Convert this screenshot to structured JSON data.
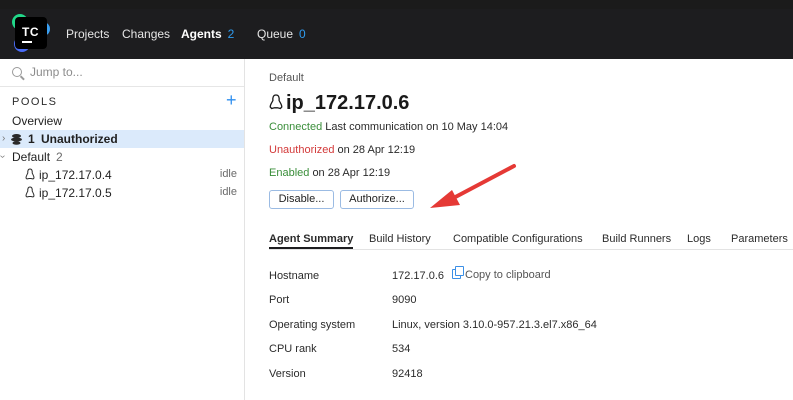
{
  "nav": {
    "logo_text": "TC",
    "projects": "Projects",
    "changes": "Changes",
    "agents": "Agents",
    "agents_count": "2",
    "queue": "Queue",
    "queue_count": "0"
  },
  "sidebar": {
    "search_placeholder": "Jump to...",
    "pools_label": "POOLS",
    "add_label": "+",
    "overview": "Overview",
    "unauthorized_count": "1",
    "unauthorized_label": "Unauthorized",
    "default_pool": "Default",
    "default_pool_count": "2",
    "agents": [
      {
        "name": "ip_172.17.0.4",
        "state": "idle"
      },
      {
        "name": "ip_172.17.0.5",
        "state": "idle"
      }
    ]
  },
  "main": {
    "breadcrumb": "Default",
    "agent_name": "ip_172.17.0.6",
    "connected_label": "Connected",
    "connected_text": "Last communication on 10 May 14:04",
    "unauthorized_label": "Unauthorized",
    "unauthorized_text": "on 28 Apr 12:19",
    "enabled_label": "Enabled",
    "enabled_text": "on 28 Apr 12:19",
    "disable_button": "Disable...",
    "authorize_button": "Authorize...",
    "tabs": [
      "Agent Summary",
      "Build History",
      "Compatible Configurations",
      "Build Runners",
      "Logs",
      "Parameters"
    ],
    "copy_label": "Copy to clipboard",
    "properties": [
      {
        "label": "Hostname",
        "value": "172.17.0.6"
      },
      {
        "label": "Port",
        "value": "9090"
      },
      {
        "label": "Operating system",
        "value": "Linux, version 3.10.0-957.21.3.el7.x86_64"
      },
      {
        "label": "CPU rank",
        "value": "534"
      },
      {
        "label": "Version",
        "value": "92418"
      }
    ]
  },
  "colors": {
    "accent": "#2f9cf0",
    "connected": "#3a8e3a",
    "unauthorized": "#d33a3a",
    "annotation_arrow": "#e53935"
  }
}
